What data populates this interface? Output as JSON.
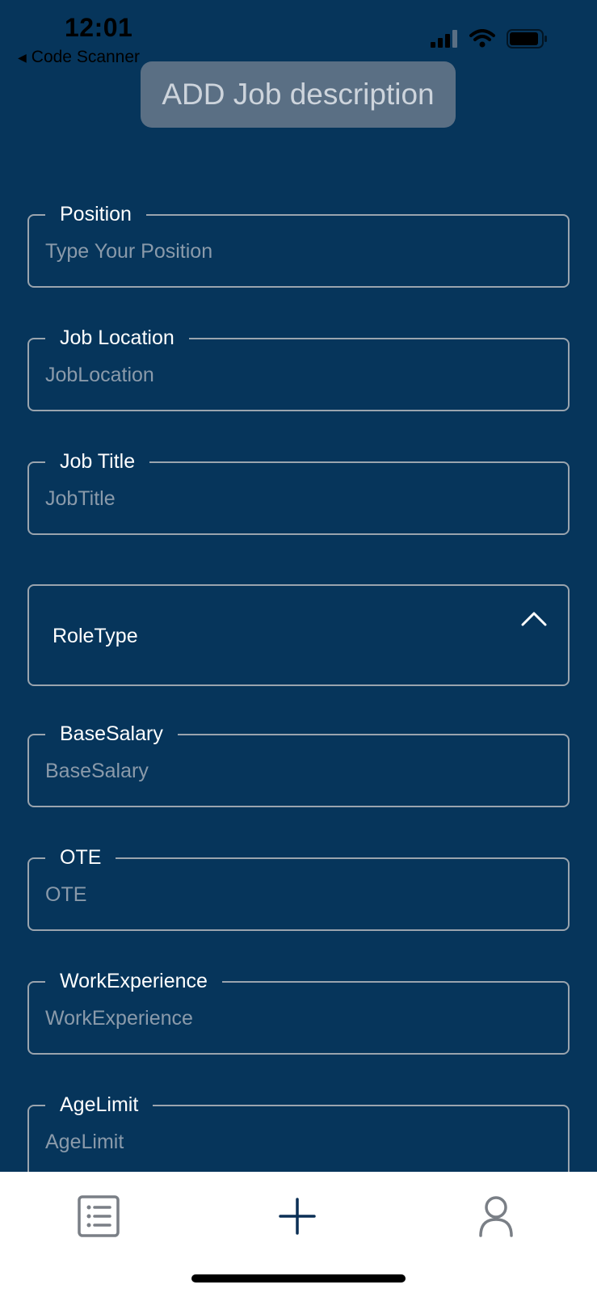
{
  "status_bar": {
    "time": "12:01",
    "back_label": "Code Scanner",
    "icons": [
      "signal-icon",
      "wifi-icon",
      "battery-icon"
    ]
  },
  "header": {
    "title": "ADD Job description"
  },
  "form": {
    "fields": [
      {
        "label": "Position",
        "placeholder": "Type Your Position"
      },
      {
        "label": "Job Location",
        "placeholder": "JobLocation"
      },
      {
        "label": "Job Title",
        "placeholder": "JobTitle"
      },
      {
        "label": "BaseSalary",
        "placeholder": "BaseSalary"
      },
      {
        "label": "OTE",
        "placeholder": "OTE"
      },
      {
        "label": "WorkExperience",
        "placeholder": "WorkExperience"
      },
      {
        "label": "AgeLimit",
        "placeholder": "AgeLimit"
      }
    ],
    "role_type": {
      "value": "RoleType",
      "icon": "chevron-up-icon"
    }
  },
  "tab_bar": {
    "tabs": [
      {
        "icon": "list-icon"
      },
      {
        "icon": "plus-icon"
      },
      {
        "icon": "profile-icon"
      }
    ]
  },
  "colors": {
    "background": "#06355b",
    "field_border": "#9aa4ae",
    "placeholder": "#8a9aaa",
    "title_button_bg": "#5a6f84",
    "tab_bar_bg": "#ffffff",
    "tab_icon_dark": "#0b2f55",
    "tab_icon_gray": "#7a7f86"
  }
}
